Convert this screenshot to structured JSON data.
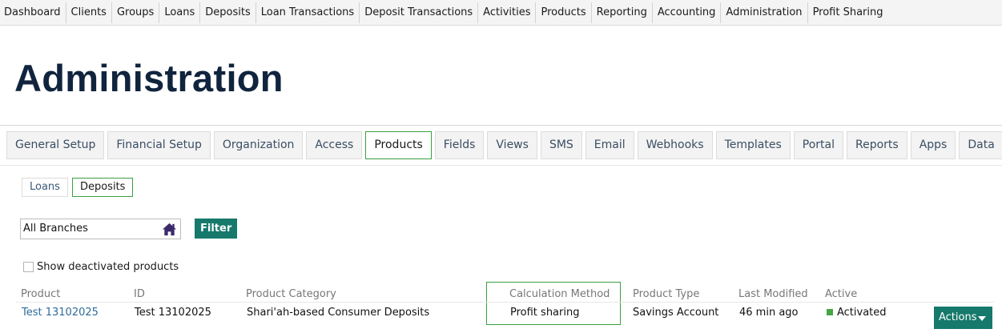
{
  "top_nav": [
    "Dashboard",
    "Clients",
    "Groups",
    "Loans",
    "Deposits",
    "Loan Transactions",
    "Deposit Transactions",
    "Activities",
    "Products",
    "Reporting",
    "Accounting",
    "Administration",
    "Profit Sharing"
  ],
  "page": {
    "title": "Administration"
  },
  "tabs": [
    "General Setup",
    "Financial Setup",
    "Organization",
    "Access",
    "Products",
    "Fields",
    "Views",
    "SMS",
    "Email",
    "Webhooks",
    "Templates",
    "Portal",
    "Reports",
    "Apps",
    "Data"
  ],
  "active_tab": "Products",
  "subtabs": [
    "Loans",
    "Deposits"
  ],
  "active_subtab": "Deposits",
  "filter": {
    "branch_value": "All Branches",
    "filter_label": "Filter",
    "show_deactivated_label": "Show deactivated products",
    "show_deactivated_checked": false
  },
  "table": {
    "headers": {
      "product": "Product",
      "id": "ID",
      "category": "Product Category",
      "calc_method": "Calculation Method",
      "type": "Product Type",
      "modified": "Last Modified",
      "active": "Active"
    },
    "rows": [
      {
        "product": "Test 13102025",
        "id": "Test 13102025",
        "category": "Shari'ah-based Consumer Deposits",
        "calc_method": "Profit sharing",
        "type": "Savings Account",
        "modified": "46 min ago",
        "active": "Activated",
        "actions_label": "Actions"
      }
    ]
  },
  "colors": {
    "accent": "#16796b",
    "active_border": "#3aa040",
    "title": "#10243e",
    "link": "#2e6b9a",
    "status_active": "#46a546",
    "home_icon": "#3b2a6b"
  }
}
